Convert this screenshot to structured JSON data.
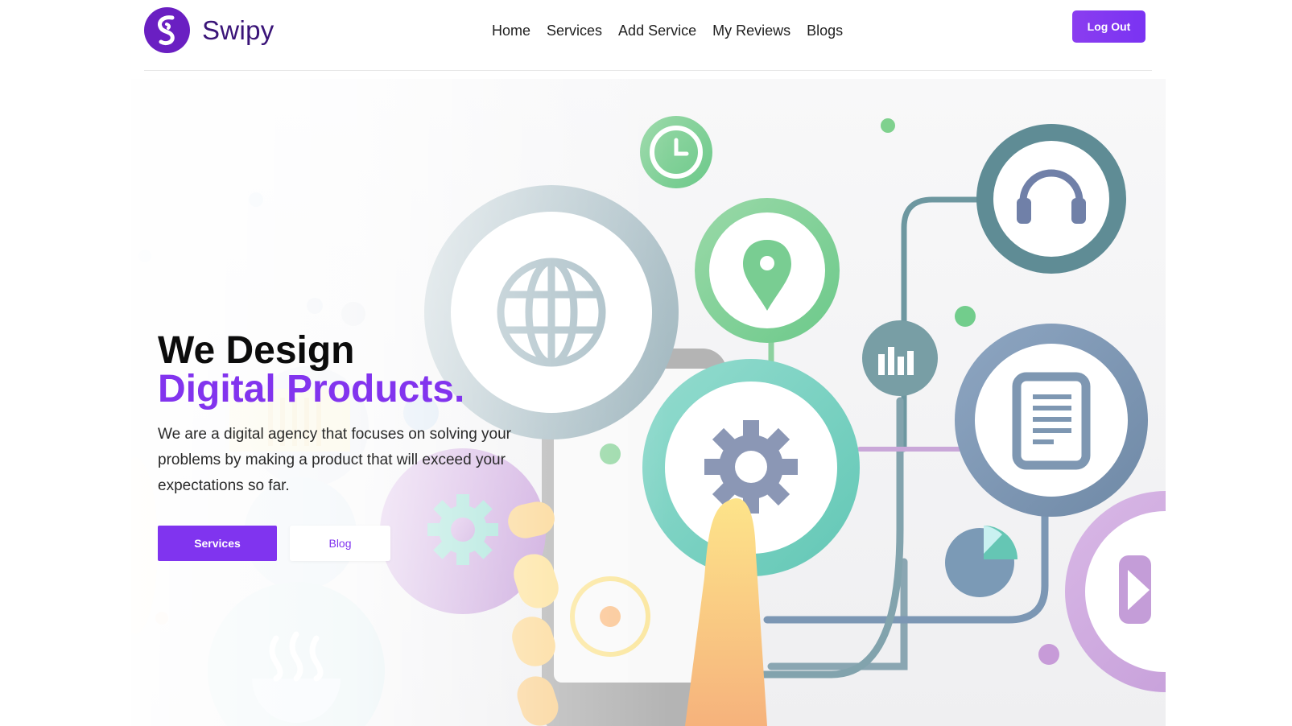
{
  "brand": {
    "name": "Swipy",
    "accent": "#7b33f0",
    "logo_icon": "s-swirl-logo-icon"
  },
  "nav": {
    "items": [
      {
        "label": "Home"
      },
      {
        "label": "Services"
      },
      {
        "label": "Add Service"
      },
      {
        "label": "My Reviews"
      },
      {
        "label": "Blogs"
      }
    ],
    "logout_label": "Log Out"
  },
  "hero": {
    "title_line1": "We Design",
    "title_line2": "Digital Products.",
    "description": "We are a digital agency that focuses on solving your problems by making a product that will exceed your expectations so far.",
    "primary_button": "Services",
    "secondary_button": "Blog",
    "illustration_icons": [
      "globe-icon",
      "clock-icon",
      "location-pin-icon",
      "headphones-icon",
      "bar-chart-icon",
      "document-icon",
      "gear-icon",
      "pie-chart-icon",
      "play-icon",
      "smartphone-icon",
      "hand-icon",
      "steaming-bowl-icon",
      "barcode-icon"
    ]
  }
}
